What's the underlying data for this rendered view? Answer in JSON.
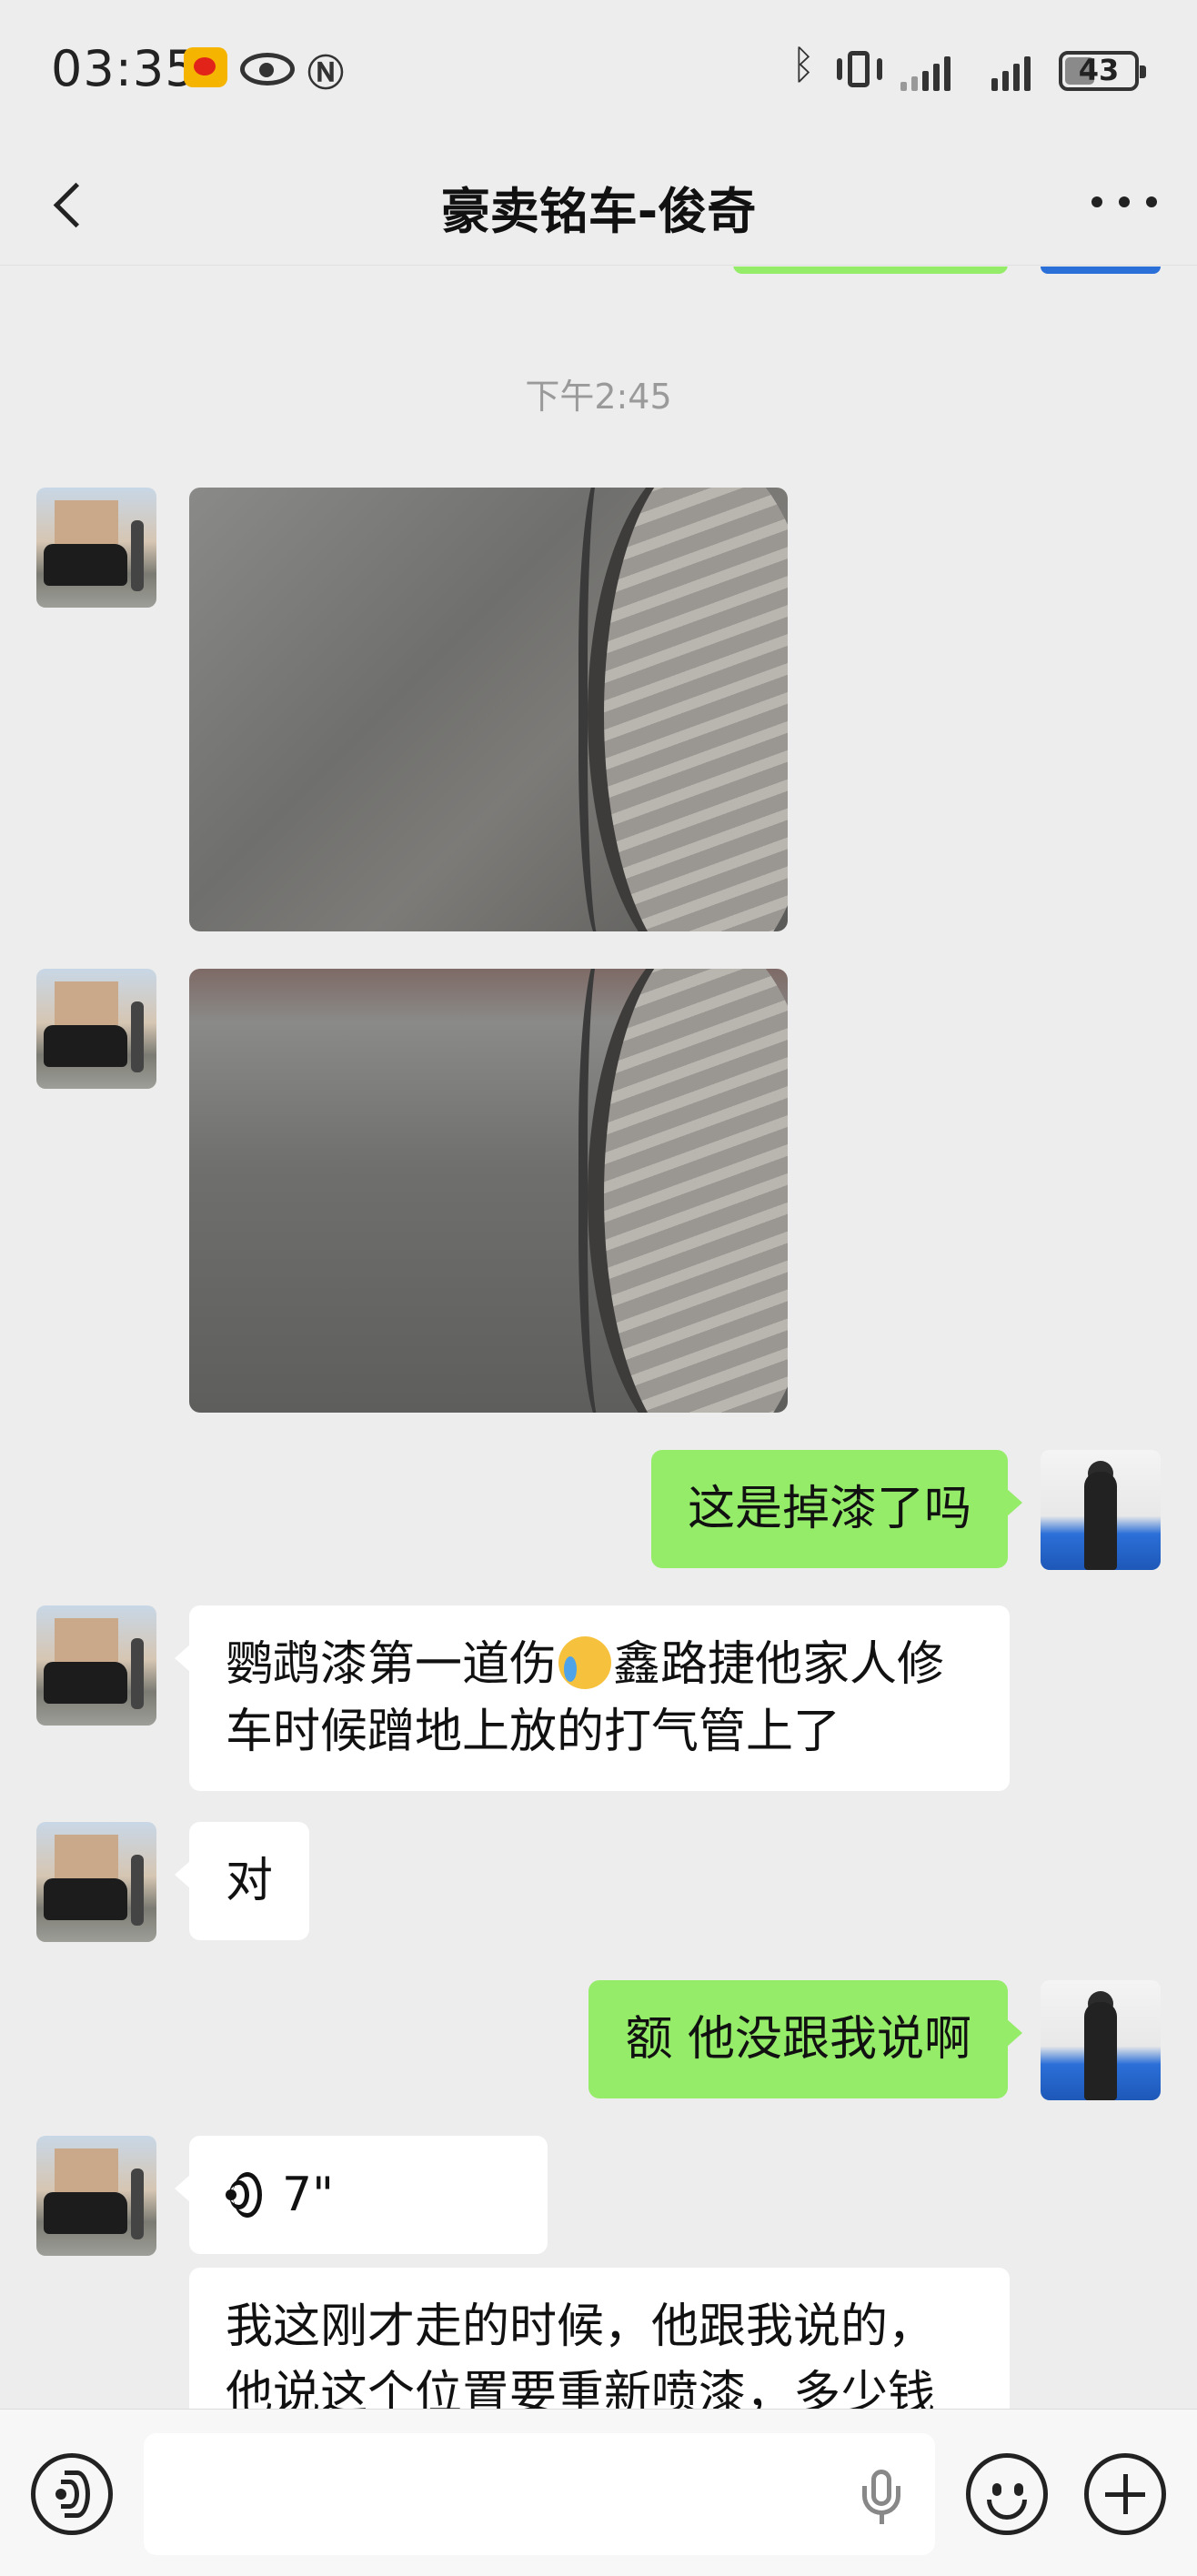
{
  "status_bar": {
    "time": "03:35",
    "battery_level": "43",
    "battery_fraction": 0.43,
    "icons": [
      "weibo-icon",
      "eye-icon",
      "nfc-icon",
      "bluetooth-icon",
      "vibrate-icon",
      "signal-icon",
      "signal-icon",
      "battery-icon"
    ]
  },
  "header": {
    "title": "豪卖铭车-俊奇",
    "back_icon": "chevron-left-icon",
    "more_icon": "more-dots-icon"
  },
  "chat": {
    "timestamp": "下午2:45",
    "messages": [
      {
        "sender": "other",
        "type": "image"
      },
      {
        "sender": "other",
        "type": "image"
      },
      {
        "sender": "me",
        "type": "text",
        "text": "这是掉漆了吗"
      },
      {
        "sender": "other",
        "type": "text",
        "text_before_emoji": "鹦鹉漆第一道伤",
        "emoji": "crying-laughing-emoji",
        "text_after_emoji": "鑫路捷他家人修车时候蹭地上放的打气管上了"
      },
      {
        "sender": "other",
        "type": "text",
        "text": "对"
      },
      {
        "sender": "me",
        "type": "text",
        "text": "额 他没跟我说啊"
      },
      {
        "sender": "other",
        "type": "voice",
        "duration": "7\""
      },
      {
        "sender": "other",
        "type": "text",
        "text": "我这刚才走的时候，他跟我说的，他说这个位置要重新喷漆，多少钱"
      }
    ]
  },
  "input_bar": {
    "value": "",
    "icons": [
      "voice-mode-icon",
      "microphone-icon",
      "emoji-icon",
      "plus-icon"
    ]
  },
  "colors": {
    "background": "#ededed",
    "my_bubble": "#95ec69",
    "their_bubble": "#ffffff",
    "timestamp_text": "#9a9a9a"
  }
}
